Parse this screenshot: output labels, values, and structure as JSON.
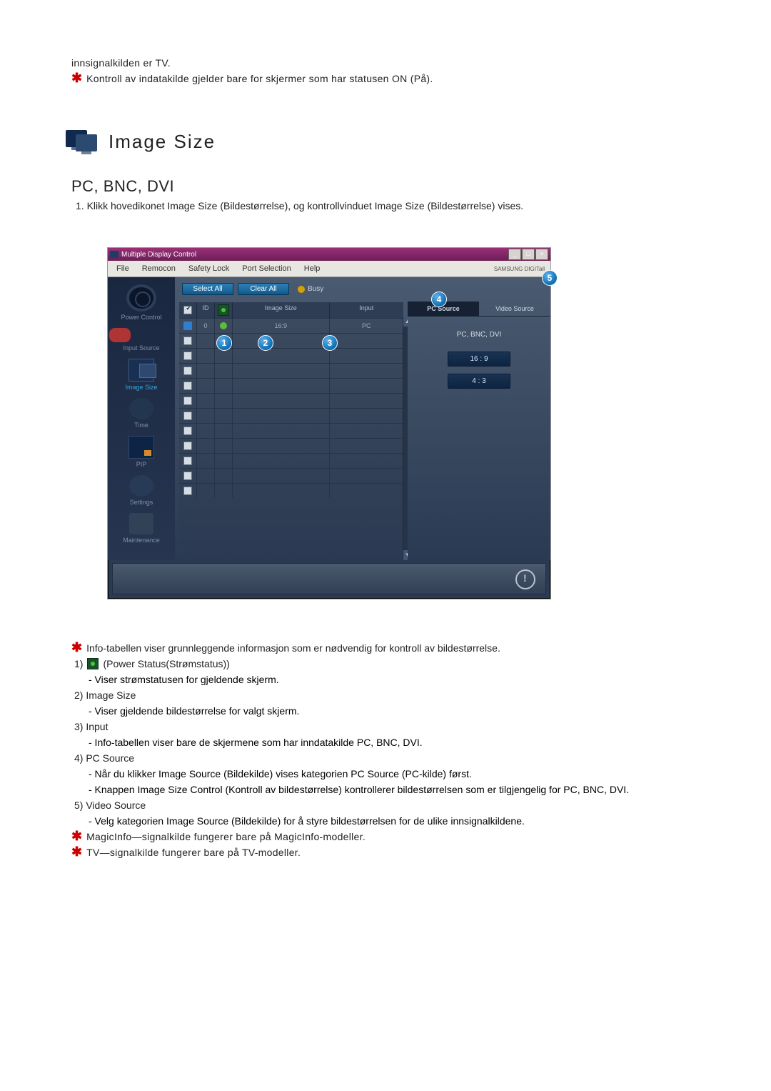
{
  "intro": {
    "line1": "innsignalkilden er TV.",
    "line2": "Kontroll av indatakilde gjelder bare for skjermer som har statusen ON (På)."
  },
  "section": {
    "title": "Image Size",
    "subsection_title": "PC, BNC, DVI",
    "subsection_desc": "1.  Klikk hovedikonet Image Size (Bildestørrelse), og kontrollvinduet Image Size (Bildestørrelse) vises."
  },
  "app": {
    "window_title": "Multiple Display Control",
    "menu": {
      "file": "File",
      "remocon": "Remocon",
      "safety": "Safety Lock",
      "port": "Port Selection",
      "help": "Help"
    },
    "brand": "SAMSUNG DIGITall",
    "sidebar": {
      "power": "Power Control",
      "input": "Input Source",
      "image": "Image Size",
      "time": "Time",
      "pip": "PIP",
      "settings": "Settings",
      "maint": "Maintenance"
    },
    "actions": {
      "select_all": "Select All",
      "clear_all": "Clear All",
      "busy": "Busy"
    },
    "grid_head": {
      "id": "ID",
      "image_size": "Image Size",
      "input": "Input"
    },
    "row0": {
      "id": "0",
      "image_size": "16:9",
      "input": "PC"
    },
    "tabs": {
      "pc": "PC Source",
      "video": "Video Source"
    },
    "panel_label": "PC, BNC, DVI",
    "size1": "16 : 9",
    "size2": "4 : 3"
  },
  "notes": {
    "n0": "Info-tabellen viser grunnleggende informasjon som er nødvendig for kontroll av bildestørrelse.",
    "n1_head": "1)",
    "n1_label": "(Power Status(Strømstatus))",
    "n1_sub": "- Viser strømstatusen for gjeldende skjerm.",
    "n2_head": "2)  Image Size",
    "n2_sub": "- Viser gjeldende bildestørrelse for valgt skjerm.",
    "n3_head": "3)  Input",
    "n3_sub": "- Info-tabellen viser bare de skjermene som har inndatakilde PC, BNC, DVI.",
    "n4_head": "4)  PC Source",
    "n4_sub1": "- Når du klikker Image Source (Bildekilde) vises kategorien PC Source (PC-kilde) først.",
    "n4_sub2": "- Knappen Image Size Control (Kontroll av bildestørrelse) kontrollerer bildestørrelsen som er tilgjengelig for PC, BNC, DVI.",
    "n5_head": "5)  Video Source",
    "n5_sub": "- Velg kategorien Image Source (Bildekilde) for å styre bildestørrelsen for de ulike innsignalkildene.",
    "n6": "MagicInfo—signalkilde fungerer bare på MagicInfo-modeller.",
    "n7": "TV—signalkilde fungerer bare på TV-modeller."
  }
}
